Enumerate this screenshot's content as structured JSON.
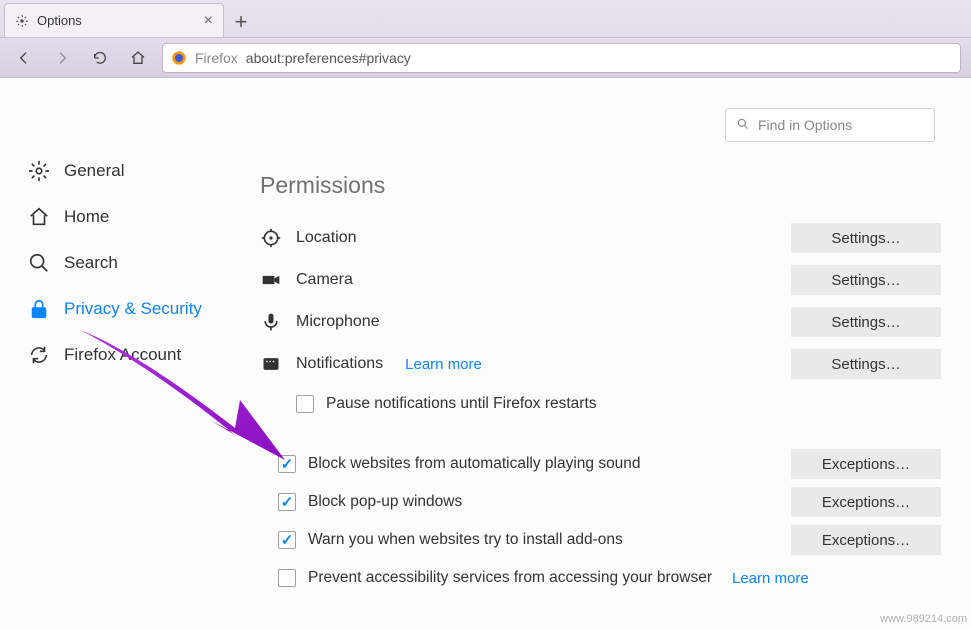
{
  "browser": {
    "tab_title": "Options",
    "url_context": "Firefox",
    "url": "about:preferences#privacy"
  },
  "search": {
    "placeholder": "Find in Options"
  },
  "sidebar": {
    "items": [
      {
        "label": "General"
      },
      {
        "label": "Home"
      },
      {
        "label": "Search"
      },
      {
        "label": "Privacy & Security"
      },
      {
        "label": "Firefox Account"
      }
    ]
  },
  "section": {
    "title": "Permissions"
  },
  "permissions": [
    {
      "label": "Location",
      "button": "Settings…"
    },
    {
      "label": "Camera",
      "button": "Settings…"
    },
    {
      "label": "Microphone",
      "button": "Settings…"
    },
    {
      "label": "Notifications",
      "button": "Settings…",
      "learn_more": "Learn more"
    }
  ],
  "notifications_sub": {
    "pause_label": "Pause notifications until Firefox restarts",
    "pause_checked": false
  },
  "checkboxes": [
    {
      "label": "Block websites from automatically playing sound",
      "checked": true,
      "button": "Exceptions…"
    },
    {
      "label": "Block pop-up windows",
      "checked": true,
      "button": "Exceptions…"
    },
    {
      "label": "Warn you when websites try to install add-ons",
      "checked": true,
      "button": "Exceptions…"
    },
    {
      "label": "Prevent accessibility services from accessing your browser",
      "checked": false,
      "learn_more": "Learn more"
    }
  ],
  "watermark": "www.989214.com"
}
